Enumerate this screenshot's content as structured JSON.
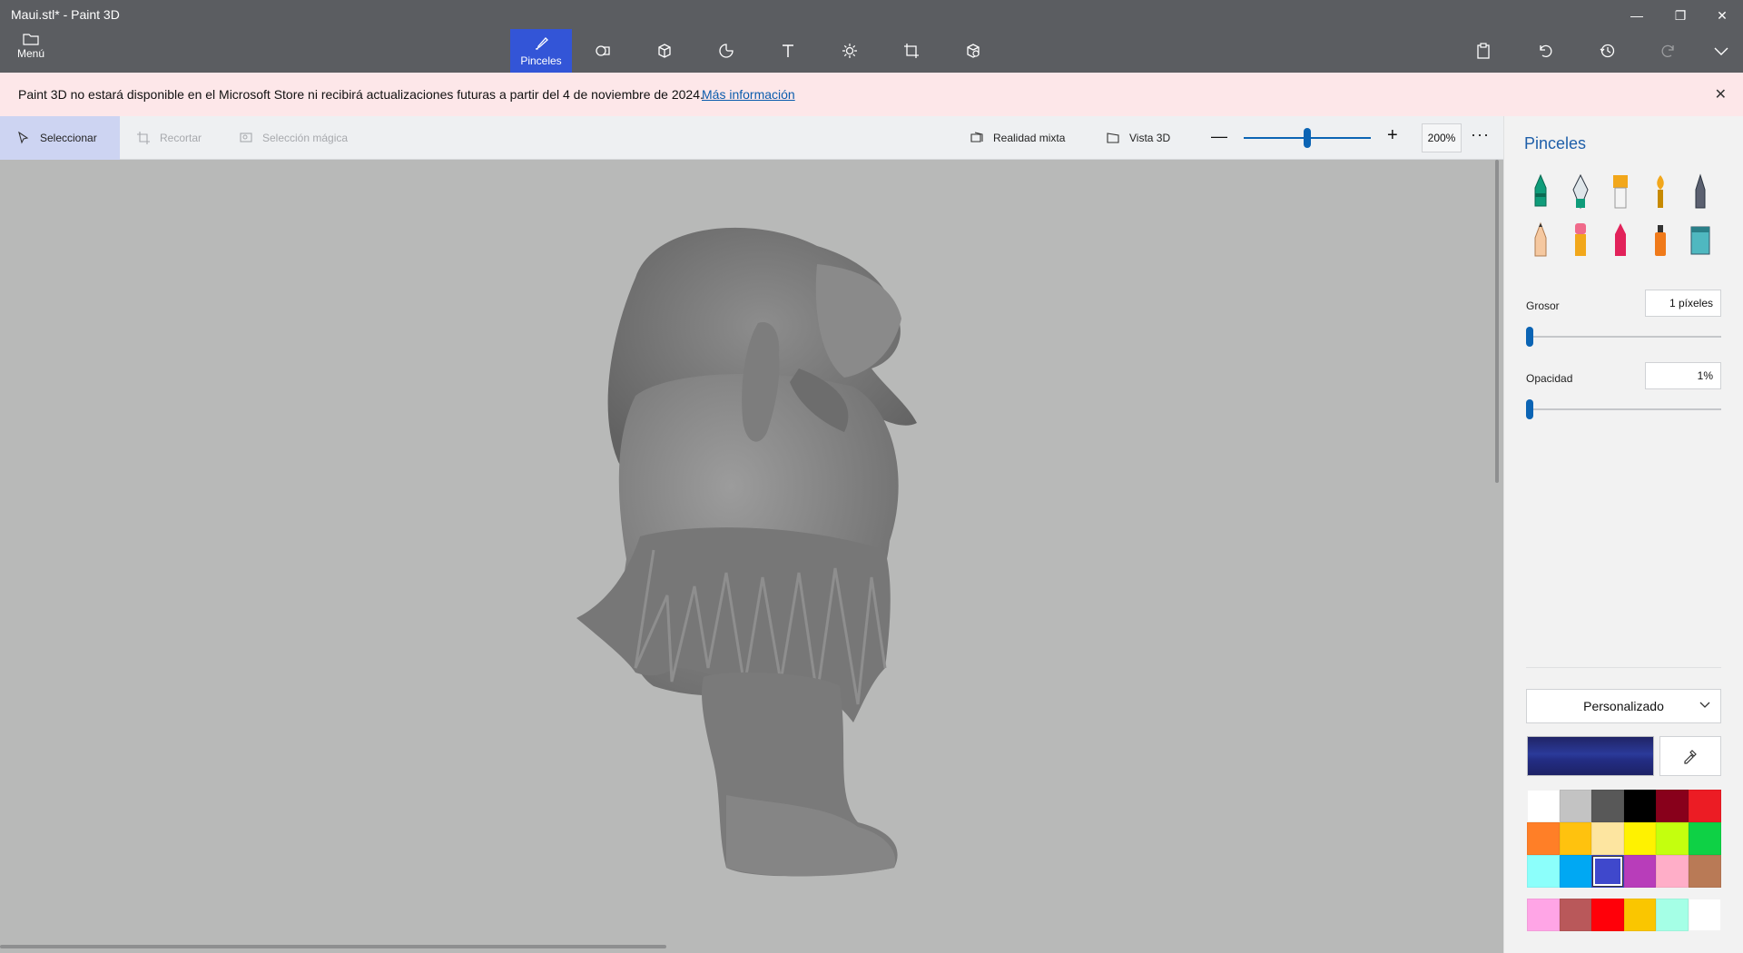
{
  "window": {
    "title": "Maui.stl* - Paint 3D",
    "controls": {
      "minimize": "—",
      "restore": "❐",
      "close": "✕"
    }
  },
  "ribbon": {
    "menu_label": "Menú",
    "active_tab_label": "Pinceles",
    "tabs": [
      {
        "icon": "brush-icon",
        "label": "Pinceles",
        "active": true
      },
      {
        "icon": "shapes-2d-icon"
      },
      {
        "icon": "shapes-3d-icon"
      },
      {
        "icon": "stickers-icon"
      },
      {
        "icon": "text-icon"
      },
      {
        "icon": "effects-icon"
      },
      {
        "icon": "canvas-icon"
      },
      {
        "icon": "3d-library-icon"
      }
    ],
    "right_icons": [
      "paste-icon",
      "undo-icon",
      "history-icon",
      "redo-icon",
      "expand-icon"
    ]
  },
  "notice": {
    "text": "Paint 3D no estará disponible en el Microsoft Store ni recibirá actualizaciones futuras a partir del 4 de noviembre de 2024.",
    "link": "Más información",
    "close": "✕"
  },
  "toolbar": {
    "select": "Seleccionar",
    "crop": "Recortar",
    "magic_select": "Selección mágica",
    "mixed_reality": "Realidad mixta",
    "view_3d": "Vista 3D",
    "zoom_minus": "—",
    "zoom_plus": "+",
    "zoom_value": "200%",
    "zoom_fraction": 0.5,
    "more": "···"
  },
  "panel": {
    "title": "Pinceles",
    "brushes": [
      "marker-icon",
      "calligraphy-pen-icon",
      "oil-brush-icon",
      "watercolor-icon",
      "pixel-pen-icon",
      "pencil-icon",
      "eraser-icon",
      "crayon-icon",
      "spray-can-icon",
      "fill-icon"
    ],
    "thickness_label": "Grosor",
    "thickness_value": "1 píxeles",
    "opacity_label": "Opacidad",
    "opacity_value": "1%",
    "color_mode": "Personalizado",
    "current_color": "#2b3a9a",
    "swatches": [
      "#ffffff",
      "#c3c3c3",
      "#585858",
      "#000000",
      "#88001b",
      "#ec1c24",
      "#ff7f27",
      "#ffc20e",
      "#fde5a0",
      "#fff200",
      "#c4ff0e",
      "#0ed145",
      "#8cfffb",
      "#00a8f3",
      "#3f48cc",
      "#b83dba",
      "#ffaec8",
      "#b97a56"
    ],
    "selected_swatch_index": 14,
    "recent_swatches": [
      "#ffa5e6",
      "#b9585a",
      "#ff0009",
      "#fac600",
      "#a5ffe6",
      "#ffffff"
    ]
  }
}
